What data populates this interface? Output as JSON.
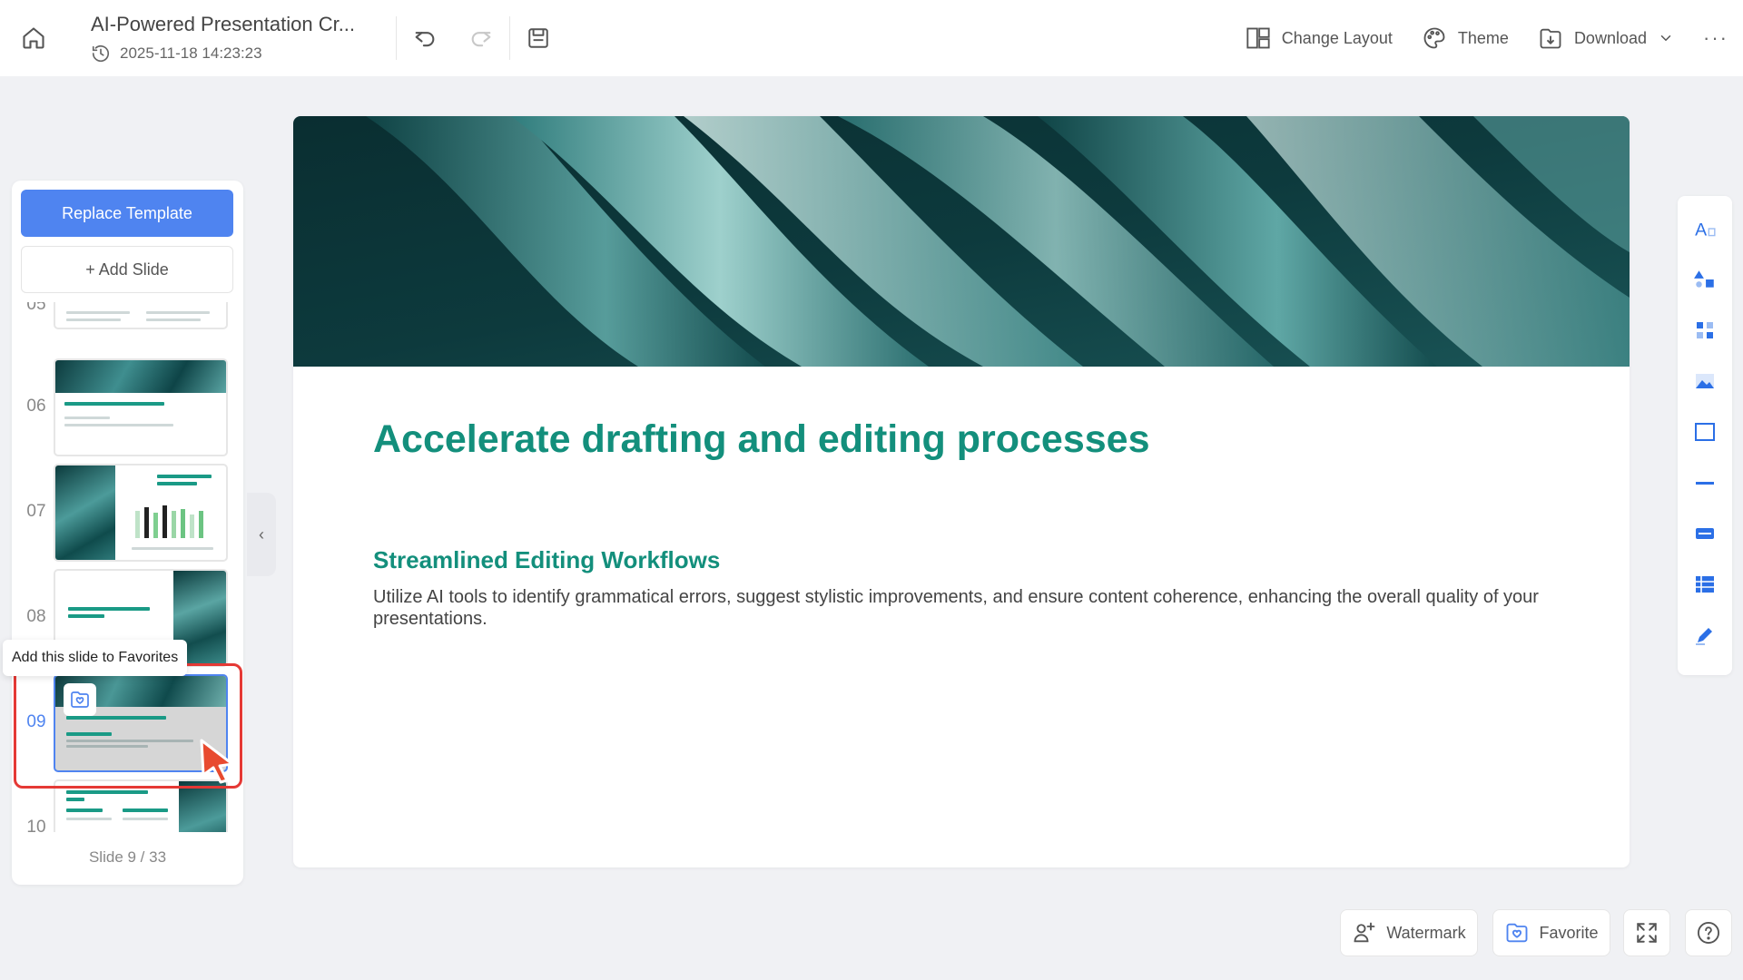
{
  "header": {
    "title": "AI-Powered Presentation Cr...",
    "timestamp": "2025-11-18 14:23:23",
    "actions": {
      "change_layout": "Change Layout",
      "theme": "Theme",
      "download": "Download",
      "more": "···"
    }
  },
  "sidebar": {
    "replace_template": "Replace Template",
    "add_slide": "+ Add Slide",
    "slides": [
      {
        "num": "05"
      },
      {
        "num": "06"
      },
      {
        "num": "07"
      },
      {
        "num": "08"
      },
      {
        "num": "09",
        "active": true
      },
      {
        "num": "10"
      }
    ],
    "counter": "Slide 9 / 33",
    "collapse": "‹",
    "tooltip": "Add this slide to Favorites"
  },
  "slide": {
    "title": "Accelerate drafting and editing processes",
    "subtitle": "Streamlined Editing Workflows",
    "body": "Utilize AI tools to identify grammatical errors, suggest stylistic improvements, and ensure content coherence, enhancing the overall quality of your presentations."
  },
  "tools": [
    "text-tool-icon",
    "shapes-tool-icon",
    "elements-tool-icon",
    "image-tool-icon",
    "frame-tool-icon",
    "divider-tool-icon",
    "banner-tool-icon",
    "table-tool-icon",
    "pen-tool-icon"
  ],
  "bottom": {
    "watermark": "Watermark",
    "favorite": "Favorite"
  },
  "colors": {
    "accent_blue": "#4f84f0",
    "slide_teal": "#138f7c",
    "highlight_red": "#e53935"
  }
}
